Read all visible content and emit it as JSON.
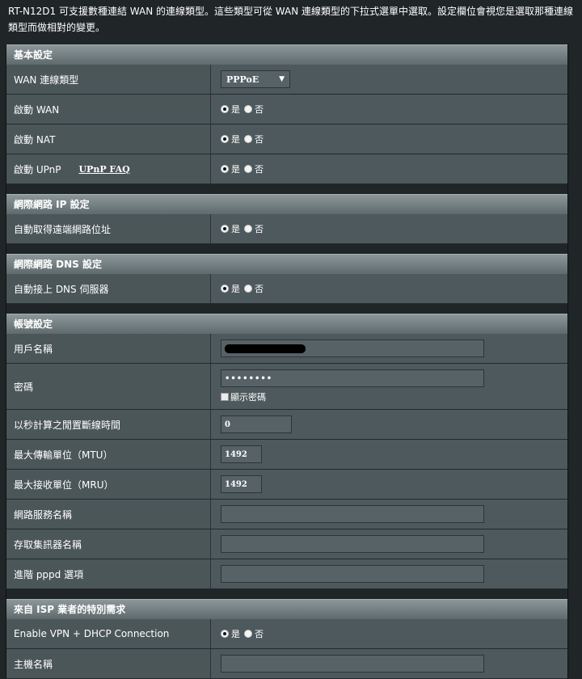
{
  "intro": "RT-N12D1 可支援數種連結 WAN 的連線類型。這些類型可從 WAN 連線類型的下拉式選單中選取。設定欄位會視您是選取那種連線類型而做相對的變更。",
  "radio": {
    "yes": "是",
    "no": "否"
  },
  "basic": {
    "title": "基本設定",
    "wan_type_label": "WAN 連線類型",
    "wan_type_value": "PPPoE",
    "enable_wan_label": "啟動 WAN",
    "enable_nat_label": "啟動 NAT",
    "enable_upnp_label": "啟動 UPnP",
    "upnp_faq": "UPnP FAQ"
  },
  "ip": {
    "title": "網際網路 IP 設定",
    "auto_ip_label": "自動取得遠端網路位址"
  },
  "dns": {
    "title": "網際網路 DNS 設定",
    "auto_dns_label": "自動接上 DNS 伺服器"
  },
  "account": {
    "title": "帳號設定",
    "username_label": "用戶名稱",
    "password_label": "密碼",
    "password_value": "••••••••",
    "show_password_label": "顯示密碼",
    "idle_label": "以秒計算之閒置斷線時間",
    "idle_value": "0",
    "mtu_label": "最大傳輸單位（MTU）",
    "mtu_value": "1492",
    "mru_label": "最大接收單位（MRU）",
    "mru_value": "1492",
    "service_label": "網路服務名稱",
    "ac_label": "存取集訊器名稱",
    "pppd_label": "進階 pppd 選項"
  },
  "isp": {
    "title": "來自 ISP 業者的特別需求",
    "vpn_dhcp_label": "Enable VPN + DHCP Connection",
    "hostname_label": "主機名稱"
  }
}
